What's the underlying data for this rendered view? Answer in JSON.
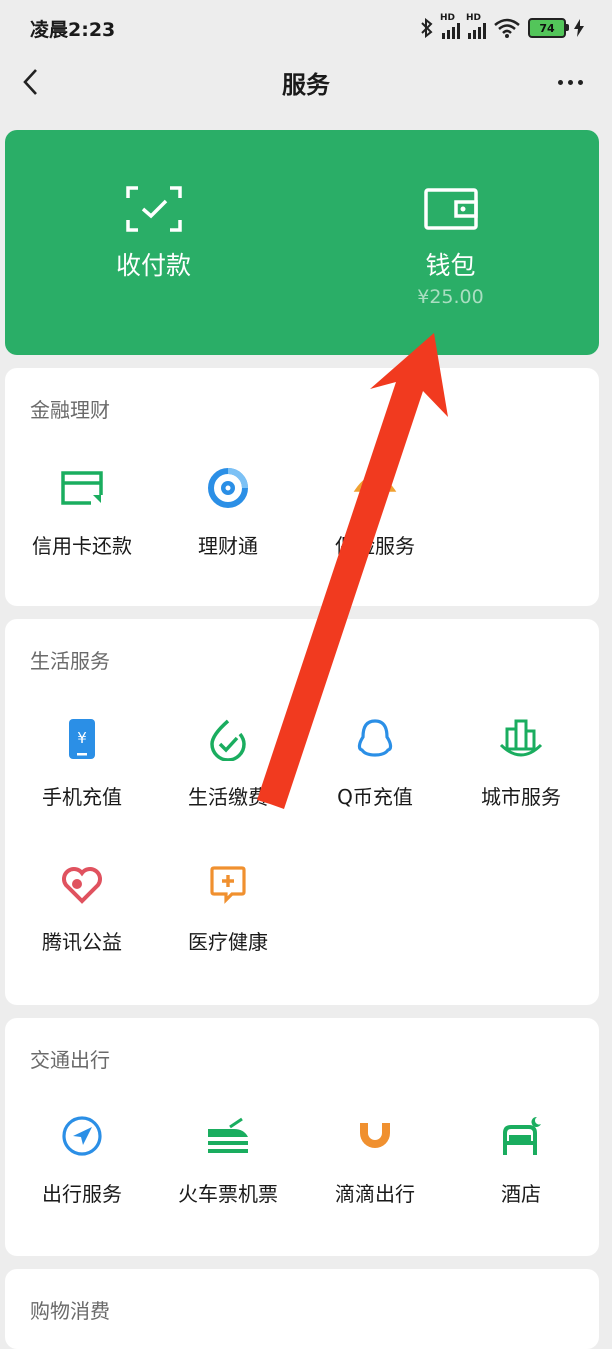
{
  "status_bar": {
    "time": "凌晨2:23",
    "battery": "74",
    "signal_tag": "HD"
  },
  "nav": {
    "title": "服务"
  },
  "top_card": {
    "pay": {
      "label": "收付款"
    },
    "wallet": {
      "label": "钱包",
      "balance": "¥25.00"
    },
    "color": "#2aae67"
  },
  "sections": {
    "finance": {
      "title": "金融理财",
      "items": [
        "信用卡还款",
        "理财通",
        "保险服务"
      ]
    },
    "life": {
      "title": "生活服务",
      "items": [
        "手机充值",
        "生活缴费",
        "Q币充值",
        "城市服务",
        "腾讯公益",
        "医疗健康"
      ]
    },
    "transport": {
      "title": "交通出行",
      "items": [
        "出行服务",
        "火车票机票",
        "滴滴出行",
        "酒店"
      ]
    },
    "shopping": {
      "title": "购物消费"
    }
  },
  "icons": {
    "credit_card": "credit-card-icon",
    "wealth": "wealth-icon",
    "insurance": "insurance-icon",
    "phone_topup": "phone-topup-icon",
    "utility": "utility-bill-icon",
    "qcoin": "qq-penguin-icon",
    "city": "city-buildings-icon",
    "charity": "heart-icon",
    "medical": "medical-kit-icon",
    "travel": "compass-icon",
    "train": "train-icon",
    "didi": "didi-icon",
    "hotel": "bed-icon"
  },
  "annotation": {
    "type": "red arrow pointing to wallet",
    "color": "#f13a1f"
  }
}
